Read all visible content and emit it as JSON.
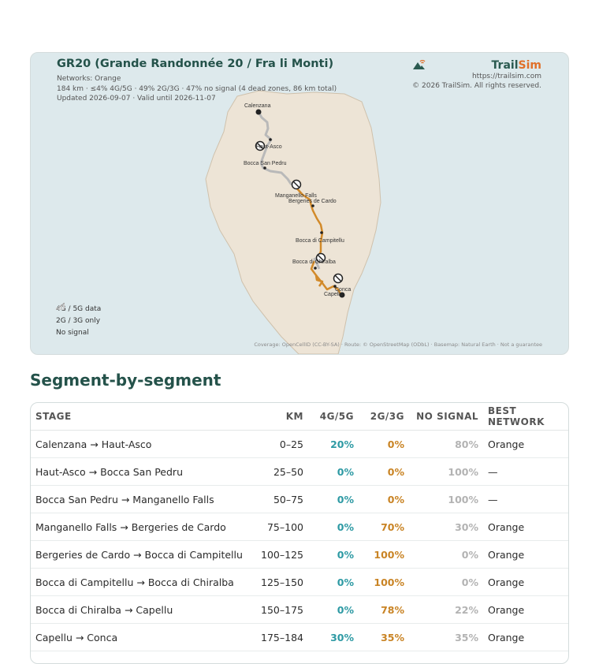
{
  "map": {
    "title": "GR20 (Grande Randonnée 20 / Fra li Monti)",
    "networks": "Networks: Orange",
    "stats": "184 km · ≤4% 4G/5G · 49% 2G/3G · 47% no signal (4 dead zones, 86 km total)",
    "updated": "Updated 2026-09-07 · Valid until 2026-11-07",
    "brand": {
      "name_part1": "Trail",
      "name_part2": "Sim",
      "url": "https://trailsim.com",
      "copyright": "© 2026 TrailSim. All rights reserved."
    },
    "legend": [
      {
        "label": "4G / 5G data",
        "icon": "signal-bars-icon",
        "color": "#2e9aa4"
      },
      {
        "label": "2G / 3G only",
        "icon": "signal-bars-icon",
        "color": "#d28a2a"
      },
      {
        "label": "No signal",
        "icon": "no-signal-icon",
        "color": "#bcbcbc"
      }
    ],
    "places": [
      "Calenzana",
      "Haut-Asco",
      "Bocca San Pedru",
      "Manganello Falls",
      "Bergeries de Cardo",
      "Bocca di Campitellu",
      "Bocca di Chiralba",
      "Conca",
      "Capellu"
    ],
    "credits": "Coverage: OpenCellID (CC-BY-SA) · Route: © OpenStreetMap (ODbL) · Basemap: Natural Earth · Not a guarantee",
    "colors": {
      "sea": "#dde9ec",
      "land": "#ede4d6",
      "coast": "#cfc1ac",
      "route_2g3g": "#d28a2a",
      "route_none": "#b9b9b9"
    }
  },
  "section_title": "Segment-by-segment",
  "table": {
    "headers": {
      "stage": "STAGE",
      "km": "KM",
      "g45": "4G/5G",
      "g23": "2G/3G",
      "none": "NO SIGNAL",
      "network": "BEST NETWORK"
    },
    "rows": [
      {
        "stage": "Calenzana → Haut-Asco",
        "km": "0–25",
        "g45": "20%",
        "g23": "0%",
        "none": "80%",
        "network": "Orange"
      },
      {
        "stage": "Haut-Asco → Bocca San Pedru",
        "km": "25–50",
        "g45": "0%",
        "g23": "0%",
        "none": "100%",
        "network": "—"
      },
      {
        "stage": "Bocca San Pedru → Manganello Falls",
        "km": "50–75",
        "g45": "0%",
        "g23": "0%",
        "none": "100%",
        "network": "—"
      },
      {
        "stage": "Manganello Falls → Bergeries de Cardo",
        "km": "75–100",
        "g45": "0%",
        "g23": "70%",
        "none": "30%",
        "network": "Orange"
      },
      {
        "stage": "Bergeries de Cardo → Bocca di Campitellu",
        "km": "100–125",
        "g45": "0%",
        "g23": "100%",
        "none": "0%",
        "network": "Orange"
      },
      {
        "stage": "Bocca di Campitellu → Bocca di Chiralba",
        "km": "125–150",
        "g45": "0%",
        "g23": "100%",
        "none": "0%",
        "network": "Orange"
      },
      {
        "stage": "Bocca di Chiralba → Capellu",
        "km": "150–175",
        "g45": "0%",
        "g23": "78%",
        "none": "22%",
        "network": "Orange"
      },
      {
        "stage": "Capellu → Conca",
        "km": "175–184",
        "g45": "30%",
        "g23": "35%",
        "none": "35%",
        "network": "Orange"
      }
    ]
  }
}
